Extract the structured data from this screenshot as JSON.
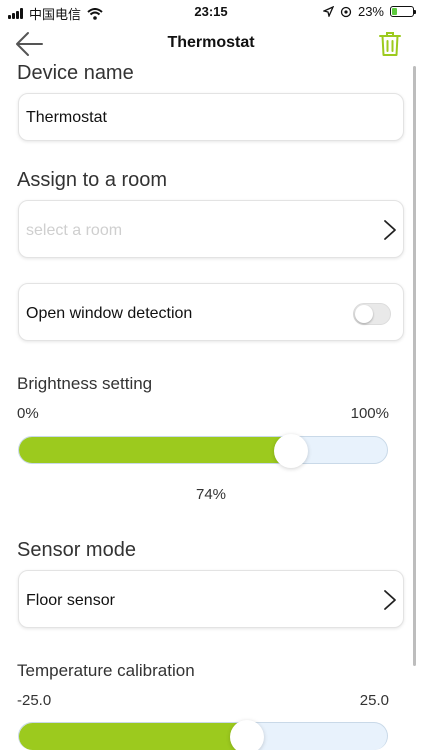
{
  "status_bar": {
    "carrier": "中国电信",
    "time": "23:15",
    "battery": "23%",
    "battery_level": 0.23
  },
  "nav": {
    "title": "Thermostat",
    "back_icon": "back-arrow-icon",
    "trash_icon": "trash-icon"
  },
  "device_name": {
    "label": "Device name",
    "value": "Thermostat"
  },
  "room": {
    "label": "Assign to a room",
    "placeholder": "select a room"
  },
  "open_window": {
    "label": "Open window detection",
    "enabled": false
  },
  "brightness": {
    "label": "Brightness setting",
    "min_label": "0%",
    "max_label": "100%",
    "value_label": "74%",
    "value": 0.74
  },
  "sensor": {
    "label": "Sensor mode",
    "value": "Floor sensor"
  },
  "calibration": {
    "label": "Temperature calibration",
    "min_label": "-25.0",
    "max_label": "25.0"
  },
  "colors": {
    "accent": "#9cca1e",
    "track": "#e8f2fc"
  }
}
